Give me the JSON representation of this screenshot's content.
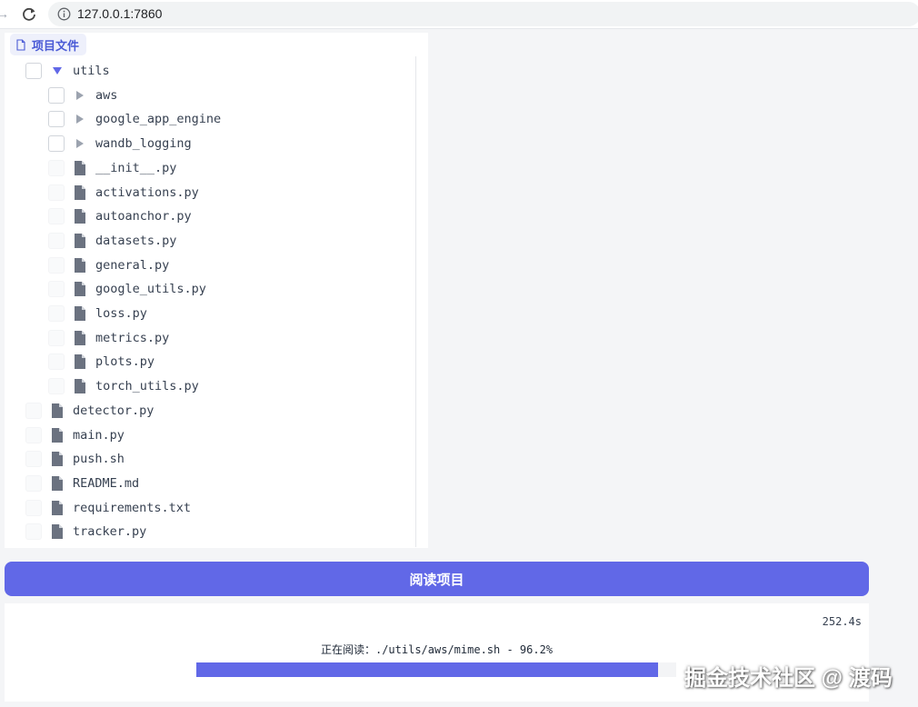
{
  "browser": {
    "url": "127.0.0.1:7860"
  },
  "panel": {
    "tab_label": "项目文件"
  },
  "tree": [
    {
      "label": "utils",
      "type": "folder-open",
      "depth": 0
    },
    {
      "label": "aws",
      "type": "folder-closed",
      "depth": 1
    },
    {
      "label": "google_app_engine",
      "type": "folder-closed",
      "depth": 1
    },
    {
      "label": "wandb_logging",
      "type": "folder-closed",
      "depth": 1
    },
    {
      "label": "__init__.py",
      "type": "file",
      "depth": 1
    },
    {
      "label": "activations.py",
      "type": "file",
      "depth": 1
    },
    {
      "label": "autoanchor.py",
      "type": "file",
      "depth": 1
    },
    {
      "label": "datasets.py",
      "type": "file",
      "depth": 1
    },
    {
      "label": "general.py",
      "type": "file",
      "depth": 1
    },
    {
      "label": "google_utils.py",
      "type": "file",
      "depth": 1
    },
    {
      "label": "loss.py",
      "type": "file",
      "depth": 1
    },
    {
      "label": "metrics.py",
      "type": "file",
      "depth": 1
    },
    {
      "label": "plots.py",
      "type": "file",
      "depth": 1
    },
    {
      "label": "torch_utils.py",
      "type": "file",
      "depth": 1
    },
    {
      "label": "detector.py",
      "type": "file",
      "depth": 0
    },
    {
      "label": "main.py",
      "type": "file",
      "depth": 0
    },
    {
      "label": "push.sh",
      "type": "file",
      "depth": 0
    },
    {
      "label": "README.md",
      "type": "file",
      "depth": 0
    },
    {
      "label": "requirements.txt",
      "type": "file",
      "depth": 0
    },
    {
      "label": "tracker.py",
      "type": "file",
      "depth": 0
    }
  ],
  "actions": {
    "read_button_label": "阅读项目"
  },
  "progress": {
    "elapsed": "252.4s",
    "status_prefix": "正在阅读：",
    "status_detail": "./utils/aws/mime.sh - 96.2%",
    "percent": 96.2
  },
  "watermark": "掘金技术社区 @ 渡码",
  "colors": {
    "accent": "#6168e7",
    "tab_bg": "#eef0fb",
    "tab_text": "#4b5bd6"
  },
  "icons": {
    "forward": "arrow-right-icon",
    "reload": "reload-icon",
    "site_info": "info-icon",
    "tab": "file-outline-icon",
    "folder_open": "caret-down-icon",
    "folder_closed": "caret-right-icon",
    "file": "file-icon"
  }
}
